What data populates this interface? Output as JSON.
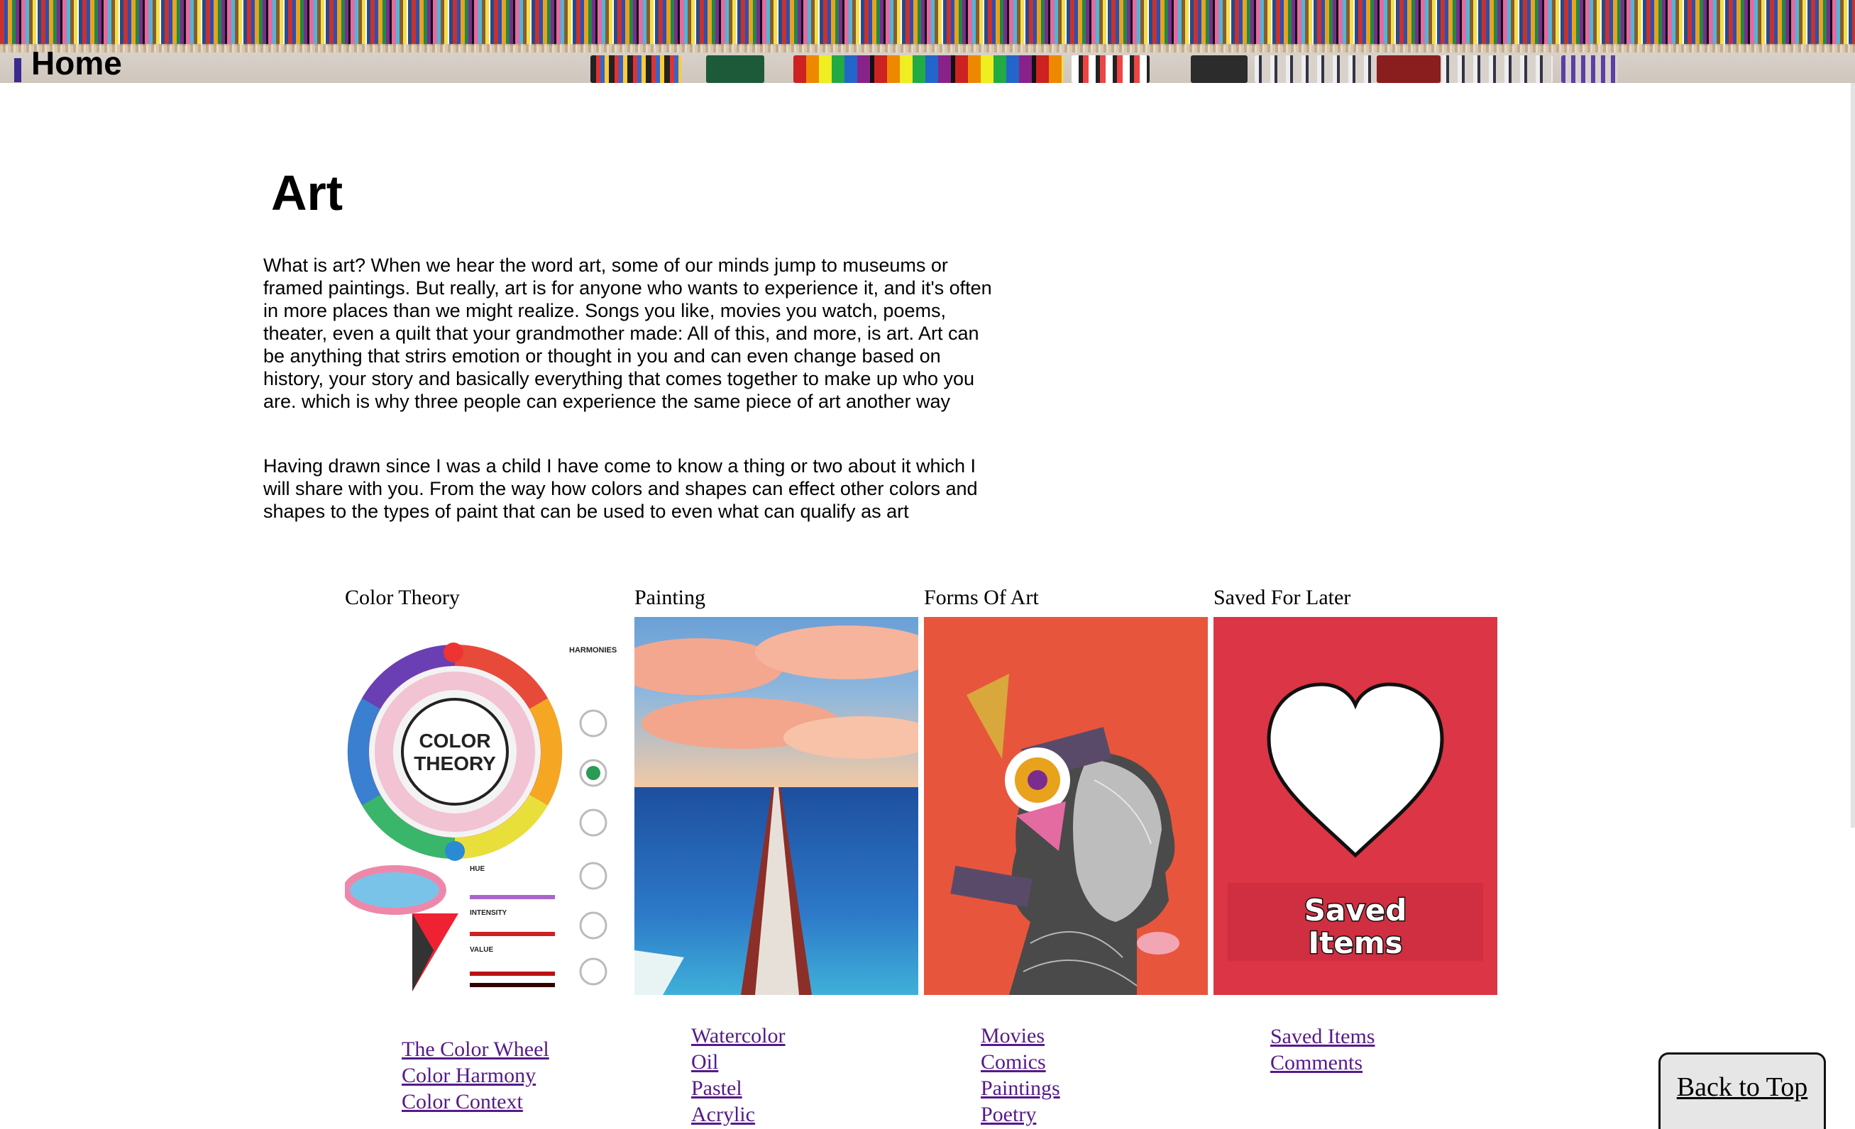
{
  "header": {
    "home_label": "Home"
  },
  "main": {
    "title": "Art",
    "intro_paragraphs": [
      "What is art? When we hear the word art, some of our minds jump to museums or framed paintings. But really, art is for anyone who wants to experience it, and it's often in more places than we might realize. Songs you like, movies you watch, poems, theater, even a quilt that your grandmother made: All of this, and more, is art. Art can be anything that strirs emotion or thought in you and can even change based on history, your story and basically everything that comes together to make up who you are. which is why three people can experience the same piece of art another way",
      "Having drawn since I was a child I have come to know a thing or two about it which I will share with you. From the way how colors and shapes can effect other colors and shapes to the types of paint that can be used to even what can qualify as art"
    ]
  },
  "cards": [
    {
      "title": "Color Theory",
      "image_text": {
        "wheel_line1": "COLOR",
        "wheel_line2": "THEORY",
        "harmonies": "HARMONIES",
        "hue": "HUE",
        "intensity": "INTENSITY",
        "value": "VALUE"
      },
      "links": [
        "The Color Wheel",
        "Color Harmony",
        "Color Context"
      ]
    },
    {
      "title": "Painting",
      "links": [
        "Watercolor",
        "Oil",
        "Pastel",
        "Acrylic"
      ]
    },
    {
      "title": "Forms Of Art",
      "links": [
        "Movies",
        "Comics",
        "Paintings",
        "Poetry"
      ]
    },
    {
      "title": "Saved For Later",
      "image_text": {
        "line1": "Saved",
        "line2": "Items"
      },
      "links": [
        "Saved Items",
        "Comments"
      ]
    }
  ],
  "back_to_top": "Back to Top",
  "colors": {
    "link": "#551a8b",
    "saved_bg": "#dc3545",
    "collage_bg": "#e8553d"
  }
}
